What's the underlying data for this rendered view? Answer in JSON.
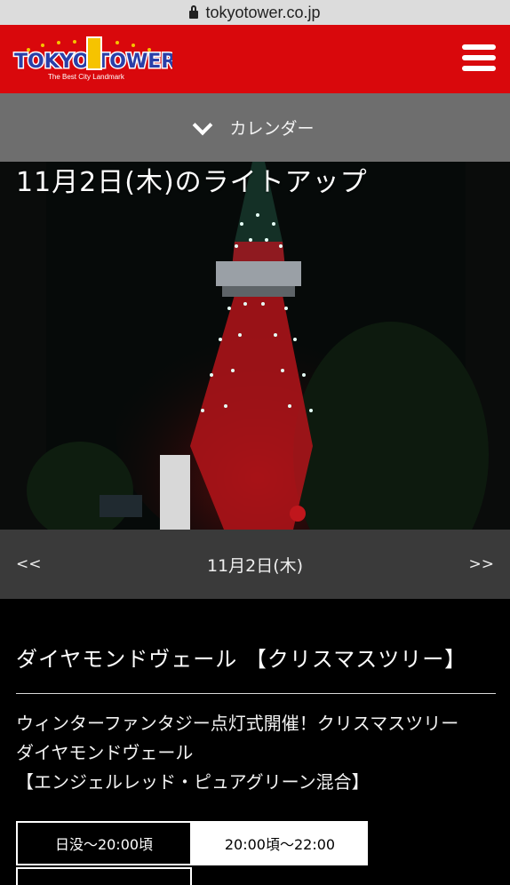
{
  "browser": {
    "url": "tokyotower.co.jp"
  },
  "header": {
    "logo_text": "TOKYO TOWER",
    "logo_tagline": "The Best City Landmark",
    "menu_icon": "hamburger-menu-icon",
    "color": "#d9080c"
  },
  "calendar_toggle": {
    "label": "カレンダー",
    "icon": "chevron-down-icon"
  },
  "hero": {
    "title": "11月2日(木)のライトアップ"
  },
  "date_nav": {
    "prev": "<<",
    "date": "11月2日(木)",
    "next": ">>"
  },
  "event": {
    "title": "ダイヤモンドヴェール 【クリスマスツリー】",
    "description_lines": [
      "ウィンターファンタジー点灯式開催！クリスマスツリー",
      "ダイヤモンドヴェール",
      "【エンジェルレッド・ピュアグリーン混合】"
    ]
  },
  "time_tabs": [
    {
      "label": "日没〜20:00頃",
      "active": false
    },
    {
      "label": "20:00頃〜22:00",
      "active": true
    }
  ]
}
